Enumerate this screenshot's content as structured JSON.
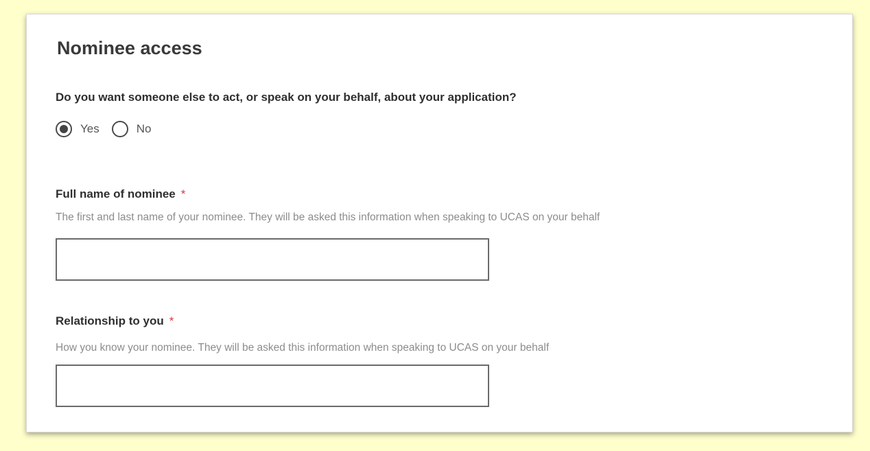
{
  "form": {
    "title": "Nominee access",
    "question": "Do you want someone else to act, or speak on your behalf, about your application?",
    "options": [
      {
        "label": "Yes",
        "selected": true
      },
      {
        "label": "No",
        "selected": false
      }
    ],
    "required_marker": "*",
    "fields": [
      {
        "label": "Full name of nominee",
        "hint": "The first and last name of your nominee. They will be asked this information when speaking to UCAS on your behalf",
        "value": ""
      },
      {
        "label": "Relationship to you",
        "hint": "How you know your nominee. They will be asked this information when speaking to UCAS on your behalf",
        "value": ""
      }
    ]
  }
}
